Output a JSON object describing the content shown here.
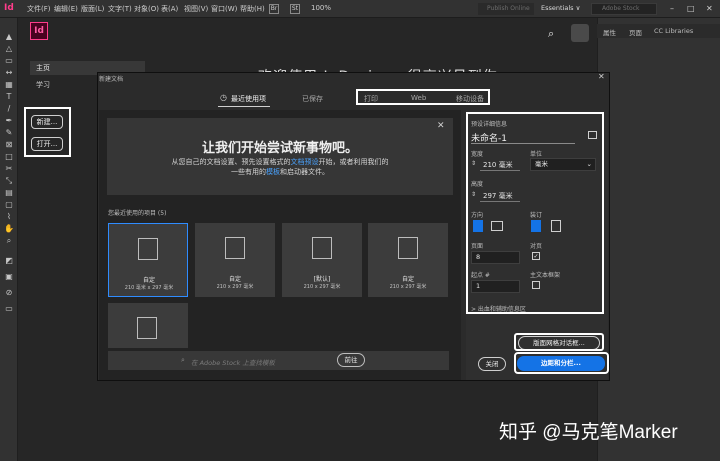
{
  "menubar": {
    "logo": "Id",
    "items": [
      "文件(F)",
      "编辑(E)",
      "版面(L)",
      "文字(T)",
      "对象(O)",
      "表(A)",
      "视图(V)",
      "窗口(W)",
      "帮助(H)"
    ],
    "br_label": "Br",
    "st_label": "St",
    "zoom": "100%",
    "publish": "Publish Online",
    "workspace": "Essentials ∨",
    "stock_search_placeholder": "Adobe Stock",
    "win_min": "–",
    "win_max": "□",
    "win_close": "✕"
  },
  "start": {
    "logo": "Id",
    "nav_home": "主页",
    "nav_learn": "学习",
    "btn_new": "新建...",
    "btn_open": "打开...",
    "welcome": "欢迎使用 InDesign，很高兴见到你。"
  },
  "panel_tabs": [
    "属性",
    "页面",
    "CC Libraries"
  ],
  "dialog": {
    "title": "新建文档",
    "close": "✕",
    "tabs": [
      "最近使用项",
      "已保存",
      "打印",
      "Web",
      "移动设备"
    ],
    "hero": {
      "title": "让我们开始尝试新事物吧。",
      "line1_a": "从您自己的文档设置、预先设置格式的",
      "line1_link": "文档预设",
      "line1_b": "开始，或者利用我们的",
      "line2_a": "一些有用的",
      "line2_link": "模板",
      "line2_b": "和启动器文件。"
    },
    "recent_label": "您最近使用的项目 (5)",
    "recent_items": [
      {
        "name": "自定",
        "size": "210 毫米 x 297 毫米"
      },
      {
        "name": "自定",
        "size": "210 x 297 毫米"
      },
      {
        "name": "[默认]",
        "size": "210 x 297 毫米"
      },
      {
        "name": "自定",
        "size": "210 x 297 毫米"
      },
      {
        "name": "",
        "size": ""
      }
    ],
    "stock_placeholder": "在 Adobe Stock 上查找模板",
    "stock_go": "前往",
    "details": {
      "section_label": "预设详细信息",
      "name": "未命名-1",
      "width_label": "宽度",
      "width_value": "210 毫米",
      "unit_label": "单位",
      "unit_value": "毫米",
      "height_label": "高度",
      "height_value": "297 毫米",
      "orientation_label": "方向",
      "binding_label": "装订",
      "pages_label": "页面",
      "pages_value": "8",
      "facing_label": "对页",
      "facing_checked": true,
      "start_label": "起点 #",
      "start_value": "1",
      "primary_frame_label": "主文本框架",
      "primary_frame_checked": false,
      "advanced_label": "> 出血和辅助信息区"
    },
    "btn_layout_grid": "版面网格对话框...",
    "btn_close": "关闭",
    "btn_margins": "边距和分栏..."
  },
  "watermark": "知乎 @马克笔Marker"
}
